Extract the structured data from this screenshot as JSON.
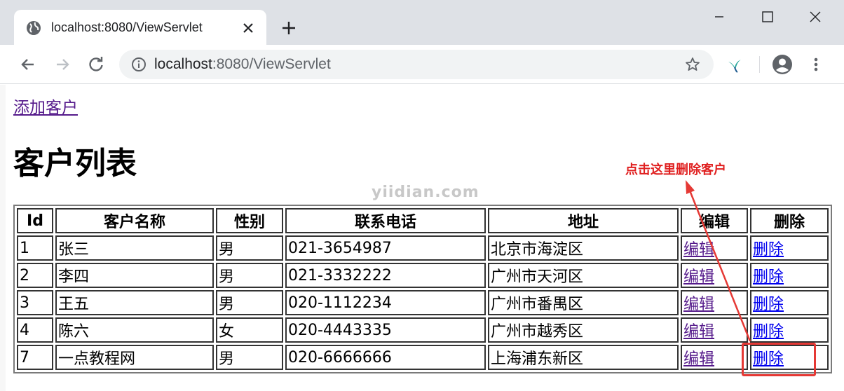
{
  "browser": {
    "tab_title": "localhost:8080/ViewServlet",
    "url_host": "localhost",
    "url_rest": ":8080/ViewServlet"
  },
  "page": {
    "add_link": "添加客户",
    "heading": "客户列表",
    "annotation": "点击这里删除客户",
    "watermark": "yiidian.com"
  },
  "table": {
    "headers": [
      "Id",
      "客户名称",
      "性别",
      "联系电话",
      "地址",
      "编辑",
      "删除"
    ],
    "rows": [
      {
        "id": "1",
        "name": "张三",
        "gender": "男",
        "phone": "021-3654987",
        "address": "北京市海淀区",
        "edit": "编辑",
        "delete": "删除"
      },
      {
        "id": "2",
        "name": "李四",
        "gender": "男",
        "phone": "021-3332222",
        "address": "广州市天河区",
        "edit": "编辑",
        "delete": "删除"
      },
      {
        "id": "3",
        "name": "王五",
        "gender": "男",
        "phone": "020-1112234",
        "address": "广州市番禺区",
        "edit": "编辑",
        "delete": "删除"
      },
      {
        "id": "4",
        "name": "陈六",
        "gender": "女",
        "phone": "020-4443335",
        "address": "广州市越秀区",
        "edit": "编辑",
        "delete": "删除"
      },
      {
        "id": "7",
        "name": "一点教程网",
        "gender": "男",
        "phone": "020-6666666",
        "address": "上海浦东新区",
        "edit": "编辑",
        "delete": "删除"
      }
    ]
  },
  "colors": {
    "annotation": "#e02020",
    "visited_link": "#551a8b",
    "link": "#0000ee"
  },
  "icons": [
    "globe-icon",
    "close-icon",
    "plus-icon",
    "minimize-icon",
    "maximize-icon",
    "back-icon",
    "forward-icon",
    "reload-icon",
    "info-icon",
    "star-icon",
    "extension-icon",
    "profile-icon",
    "menu-icon"
  ]
}
